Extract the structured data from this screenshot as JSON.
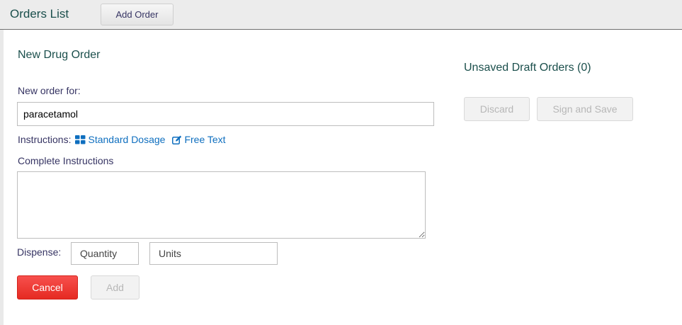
{
  "header": {
    "title": "Orders List",
    "add_order_label": "Add Order"
  },
  "form": {
    "heading": "New Drug Order",
    "new_order_label": "New order for:",
    "drug_value": "paracetamol",
    "instructions_label": "Instructions:",
    "standard_dosage_label": "Standard Dosage",
    "free_text_label": "Free Text",
    "complete_instructions_label": "Complete Instructions",
    "dispense_label": "Dispense:",
    "quantity_placeholder": "Quantity",
    "units_placeholder": "Units",
    "cancel_label": "Cancel",
    "add_label": "Add"
  },
  "drafts": {
    "heading": "Unsaved Draft Orders (0)",
    "discard_label": "Discard",
    "sign_save_label": "Sign and Save"
  },
  "colors": {
    "link": "#0f6fbf",
    "cancel": "#e52a22",
    "heading": "#1b4f4c"
  },
  "icons": {
    "standard_dosage": "grid-icon",
    "free_text": "edit-icon"
  }
}
